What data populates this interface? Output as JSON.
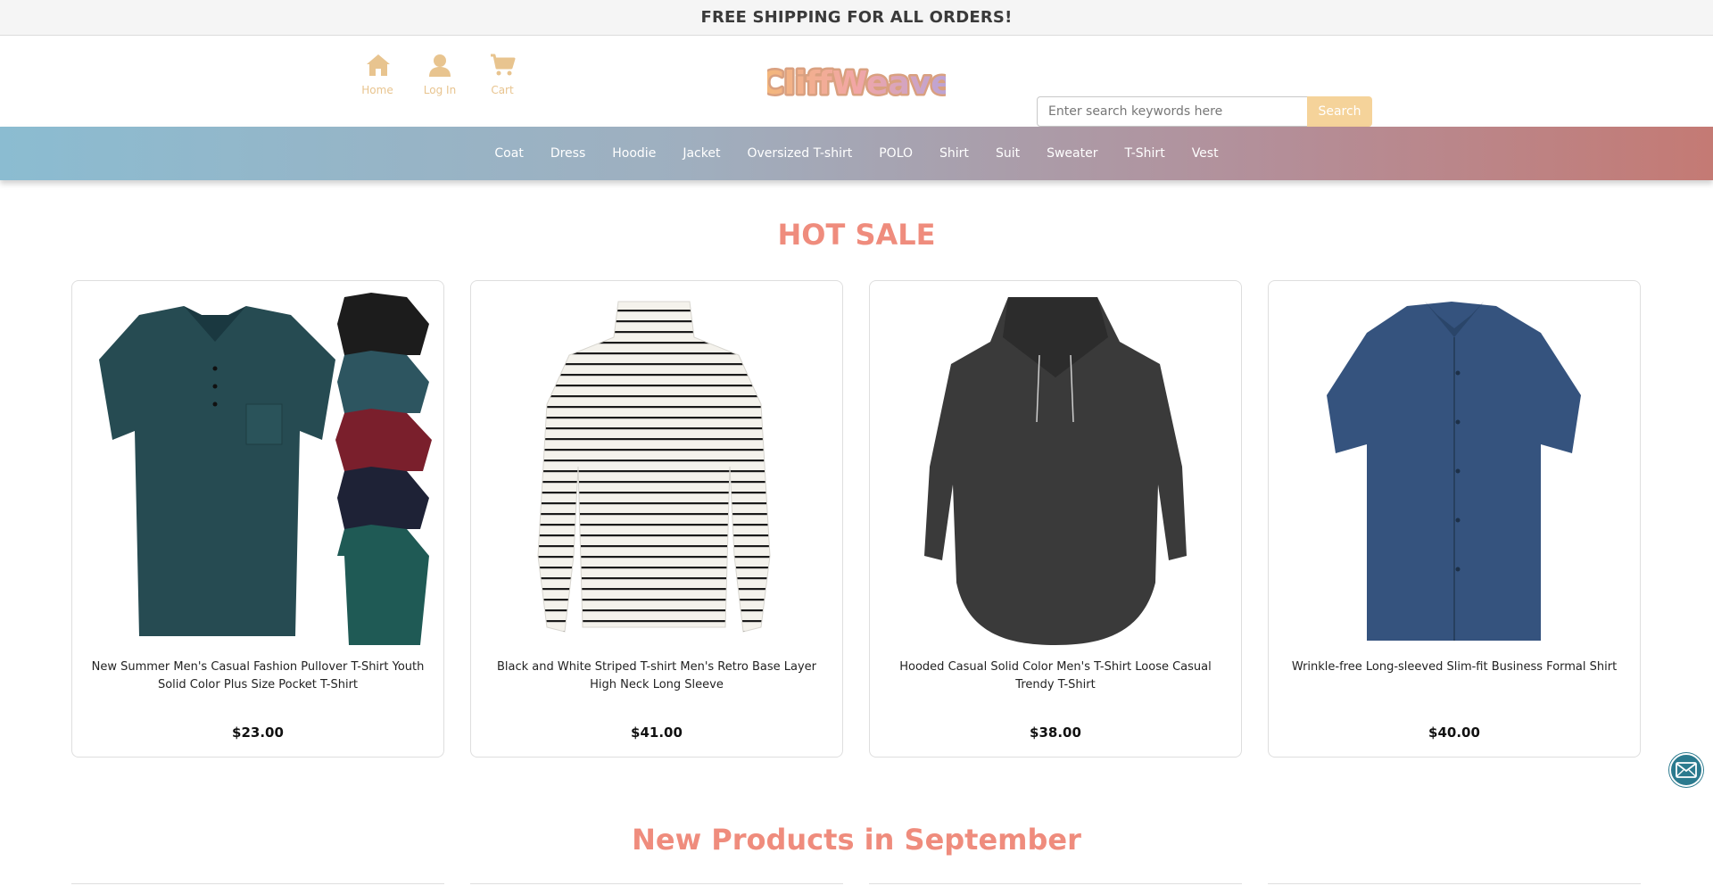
{
  "announcement": "FREE SHIPPING FOR ALL ORDERS!",
  "header": {
    "nav": [
      {
        "label": "Home",
        "icon": "home-icon"
      },
      {
        "label": "Log In",
        "icon": "user-icon"
      },
      {
        "label": "Cart",
        "icon": "cart-icon"
      }
    ],
    "logo_text": "CliffWeave",
    "search": {
      "placeholder": "Enter search keywords here",
      "button": "Search"
    }
  },
  "categories": [
    "Coat",
    "Dress",
    "Hoodie",
    "Jacket",
    "Oversized T-shirt",
    "POLO",
    "Shirt",
    "Suit",
    "Sweater",
    "T-Shirt",
    "Vest"
  ],
  "hot_sale": {
    "title": "HOT SALE",
    "products": [
      {
        "name": "New Summer Men's Casual Fashion Pullover T-Shirt Youth Solid Color Plus Size Pocket T-Shirt",
        "price": "$23.00",
        "image": "polo-shirt-green"
      },
      {
        "name": "Black and White Striped T-shirt Men's Retro Base Layer High Neck Long Sleeve",
        "price": "$41.00",
        "image": "striped-turtleneck"
      },
      {
        "name": "Hooded Casual Solid Color Men's T-Shirt Loose Casual Trendy T-Shirt",
        "price": "$38.00",
        "image": "dark-hoodie"
      },
      {
        "name": "Wrinkle-free Long-sleeved Slim-fit Business Formal Shirt",
        "price": "$40.00",
        "image": "blue-dress-shirt"
      }
    ]
  },
  "new_products": {
    "title": "New Products in September"
  },
  "colors": {
    "accent": "#ef8c7d",
    "icon_gold": "#e8c48f",
    "search_btn": "#f5d39a",
    "mail_btn": "#2b7a8e"
  },
  "float_button_icon": "mail-icon"
}
